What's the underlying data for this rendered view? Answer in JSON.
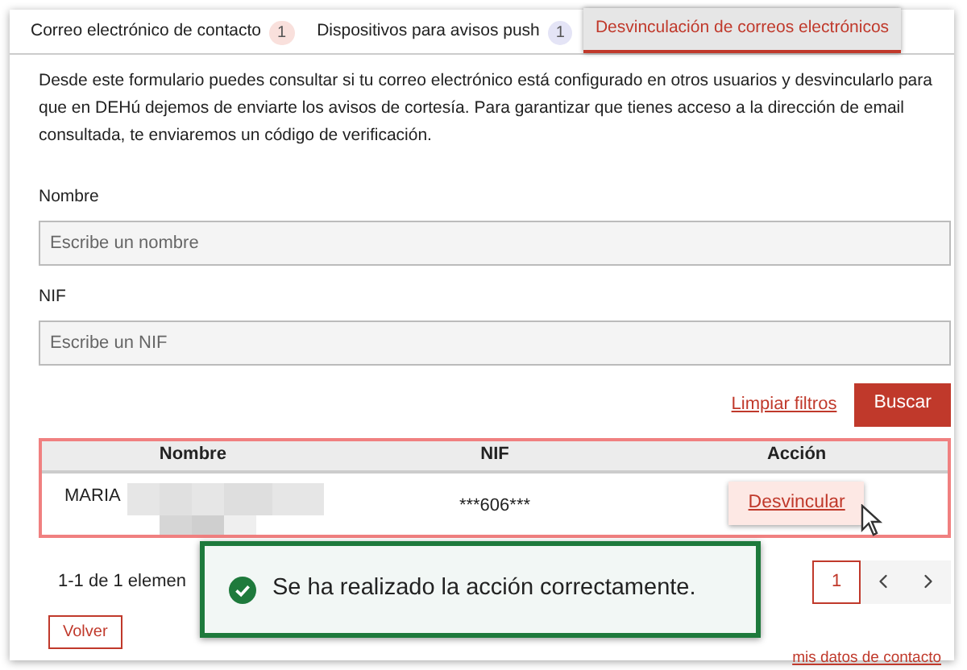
{
  "tabs": [
    {
      "label": "Correo electrónico de contacto",
      "count": "1",
      "color": "#f9e0dc",
      "selected": false
    },
    {
      "label": "Dispositivos para avisos push",
      "count": "1",
      "color": "#e4e4f6",
      "selected": false
    },
    {
      "label": "Desvinculación de correos electrónicos",
      "selected": true
    }
  ],
  "intro": "Desde este formulario puedes consultar si tu correo electrónico está configurado en otros usuarios y desvincularlo para que en DEHú dejemos de enviarte los avisos de cortesía. Para garantizar que tienes acceso a la dirección de email consultada, te enviaremos un código de verificación.",
  "fields": [
    {
      "label": "Nombre",
      "placeholder": "Escribe un nombre"
    },
    {
      "label": "NIF",
      "placeholder": "Escribe un NIF"
    }
  ],
  "clear_link": "Limpiar filtros",
  "search_button": "Buscar",
  "table": {
    "columns": [
      "Nombre",
      "NIF",
      "Acción"
    ],
    "rows": [
      {
        "name": "MARIA",
        "nif": "***606***",
        "action": "Desvincular"
      }
    ]
  },
  "pagination": {
    "summary": "1-1 de 1 elemen",
    "pages": [
      {
        "label": "1",
        "selected": true
      }
    ]
  },
  "back_button": "Volver",
  "contact_link": "mis datos de contacto",
  "toast": {
    "message": "Se ha realizado la acción correctamente."
  }
}
